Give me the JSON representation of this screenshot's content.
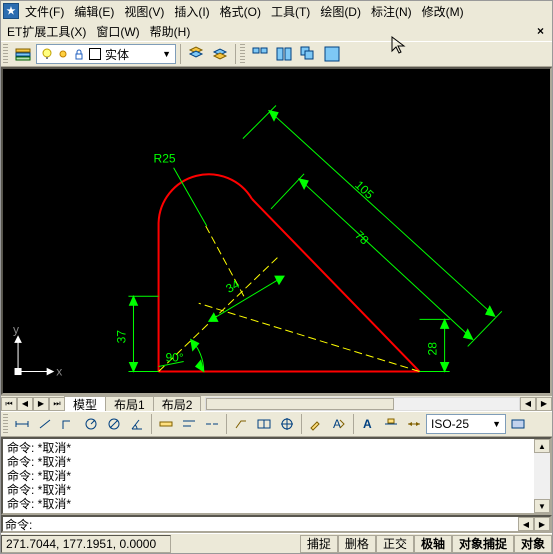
{
  "menu": {
    "file": "文件(F)",
    "edit": "编辑(E)",
    "view": "视图(V)",
    "insert": "插入(I)",
    "format": "格式(O)",
    "tools": "工具(T)",
    "draw": "绘图(D)",
    "dim": "标注(N)",
    "modify": "修改(M)",
    "et": "ET扩展工具(X)",
    "window": "窗口(W)",
    "help": "帮助(H)"
  },
  "layer": {
    "name": "实体",
    "swatch": "#ffffff"
  },
  "tabs": {
    "model": "模型",
    "layout1": "布局1",
    "layout2": "布局2"
  },
  "dimstyle": "ISO-25",
  "drawing": {
    "r_label": "R25",
    "d105": "105",
    "d78": "78",
    "d34": "34",
    "d37": "37",
    "d28": "28",
    "a90": "90°"
  },
  "axis": {
    "x": "x",
    "y": "y"
  },
  "cmd": {
    "lines": "命令: *取消*\n命令: *取消*\n命令: *取消*\n命令: *取消*\n命令: *取消*",
    "prompt": "命令:"
  },
  "status": {
    "coords": "271.7044, 177.1951, 0.0000",
    "snap": "捕捉",
    "grid": "删格",
    "ortho": "正交",
    "polar": "极轴",
    "osnap": "对象捕捉",
    "otrack": "对象"
  }
}
